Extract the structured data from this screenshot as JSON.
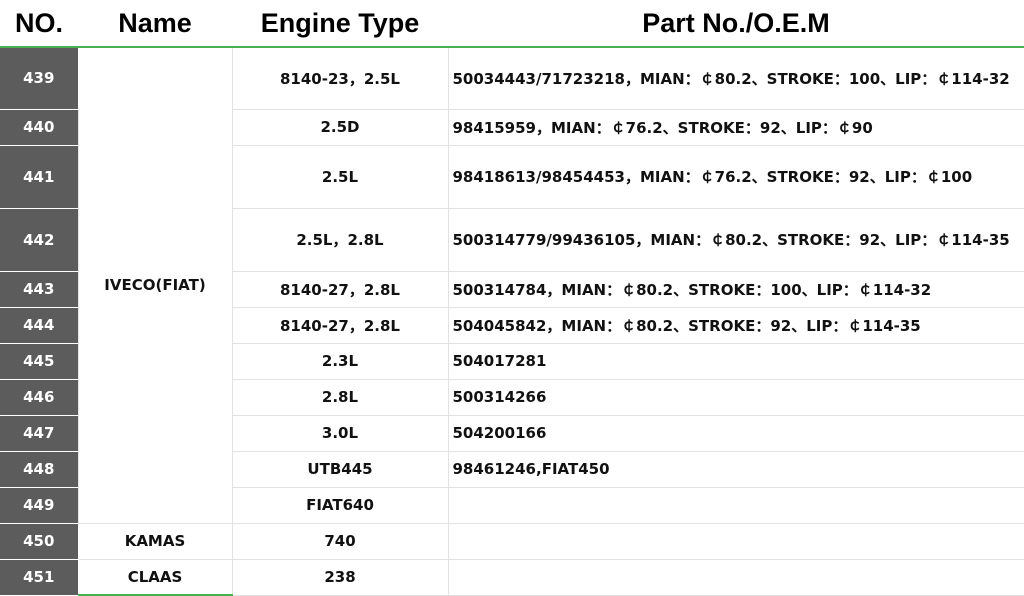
{
  "headers": {
    "no": "NO.",
    "name": "Name",
    "engine": "Engine Type",
    "part": "Part No./O.E.M"
  },
  "groups": {
    "iveco": "IVECO(FIAT)",
    "kamas": "KAMAS",
    "claas": "CLAAS"
  },
  "rows": [
    {
      "no": "439",
      "engine": "8140-23，2.5L",
      "part": "50034443/71723218，MIAN：￠80.2、STROKE：100、LIP：￠114-32"
    },
    {
      "no": "440",
      "engine": "2.5D",
      "part": "98415959，MIAN：￠76.2、STROKE：92、LIP：￠90"
    },
    {
      "no": "441",
      "engine": "2.5L",
      "part": "98418613/98454453，MIAN：￠76.2、STROKE：92、LIP：￠100"
    },
    {
      "no": "442",
      "engine": "2.5L，2.8L",
      "part": "500314779/99436105，MIAN：￠80.2、STROKE：92、LIP：￠114-35"
    },
    {
      "no": "443",
      "engine": "8140-27，2.8L",
      "part": "500314784，MIAN：￠80.2、STROKE：100、LIP：￠114-32"
    },
    {
      "no": "444",
      "engine": "8140-27，2.8L",
      "part": "504045842，MIAN：￠80.2、STROKE：92、LIP：￠114-35"
    },
    {
      "no": "445",
      "engine": "2.3L",
      "part": "504017281"
    },
    {
      "no": "446",
      "engine": "2.8L",
      "part": "500314266"
    },
    {
      "no": "447",
      "engine": "3.0L",
      "part": "504200166"
    },
    {
      "no": "448",
      "engine": "UTB445",
      "part": "98461246,FIAT450"
    },
    {
      "no": "449",
      "engine": "FIAT640",
      "part": ""
    },
    {
      "no": "450",
      "engine": "740",
      "part": ""
    },
    {
      "no": "451",
      "engine": "238",
      "part": ""
    }
  ]
}
